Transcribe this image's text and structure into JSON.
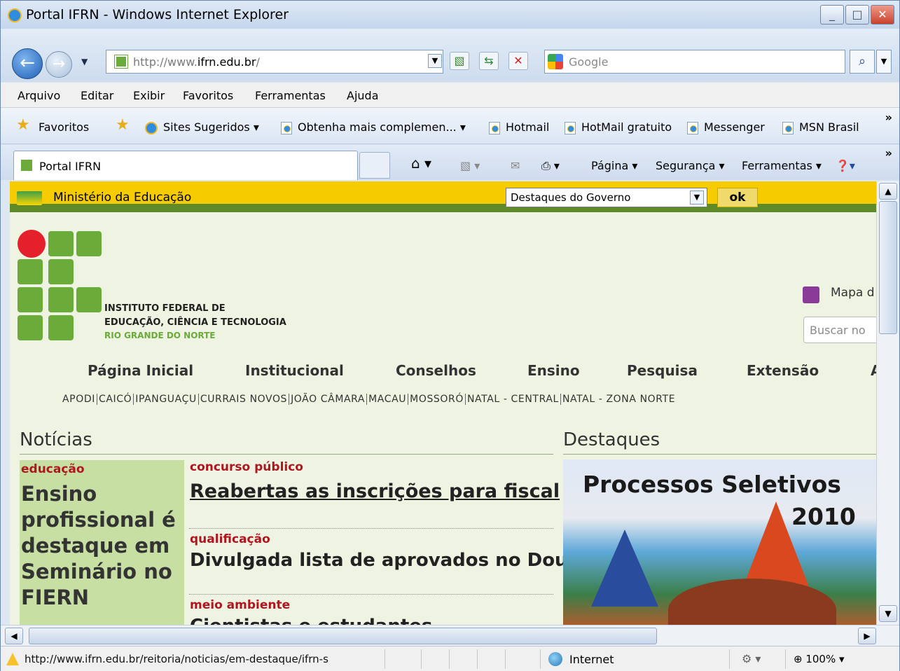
{
  "window": {
    "title": "Portal IFRN - Windows Internet Explorer"
  },
  "address": {
    "url_prefix": "http://www.",
    "url_domain": "ifrn.edu.br",
    "url_suffix": "/",
    "search_placeholder": "Google"
  },
  "menu": [
    "Arquivo",
    "Editar",
    "Exibir",
    "Favoritos",
    "Ferramentas",
    "Ajuda"
  ],
  "favorites": {
    "label": "Favoritos",
    "items": [
      "Sites Sugeridos ▾",
      "Obtenha mais complemen... ▾",
      "Hotmail",
      "HotMail gratuito",
      "Messenger",
      "MSN Brasil"
    ]
  },
  "tab": {
    "label": "Portal IFRN"
  },
  "commands": {
    "page": "Página ▾",
    "security": "Segurança ▾",
    "tools": "Ferramentas ▾"
  },
  "site": {
    "gov_label": "Ministério da Educação",
    "gov_select": "Destaques do Governo",
    "ok": "ok",
    "inst_line1": "INSTITUTO FEDERAL DE",
    "inst_line2": "EDUCAÇÃO, CIÊNCIA E TECNOLOGIA",
    "inst_line3": "RIO GRANDE DO NORTE",
    "mapa": "Mapa d",
    "search_placeholder": "Buscar no",
    "nav": [
      "Página Inicial",
      "Institucional",
      "Conselhos",
      "Ensino",
      "Pesquisa",
      "Extensão",
      "A"
    ],
    "campus": [
      "APODI",
      "CAICÓ",
      "IPANGUAÇU",
      "CURRAIS NOVOS",
      "JOÃO CÂMARA",
      "MACAU",
      "MOSSORÓ",
      "NATAL - CENTRAL",
      "NATAL - ZONA NORTE"
    ],
    "news_title": "Notícias",
    "highlights_title": "Destaques",
    "left_cat": "educação",
    "left_head": "Ensino profissional é destaque em Seminário no FIERN",
    "items": [
      {
        "cat": "concurso público",
        "title": "Reabertas as inscrições para fiscal"
      },
      {
        "cat": "qualificação",
        "title": "Divulgada lista de aprovados no Doutorado em Recursos Naturais"
      },
      {
        "cat": "meio ambiente",
        "title": "Cientistas e estudantes..."
      }
    ],
    "dest_title": "Processos Seletivos",
    "dest_year": "2010"
  },
  "status": {
    "url": "http://www.ifrn.edu.br/reitoria/noticias/em-destaque/ifrn-s",
    "zone": "Internet",
    "zoom": "100%"
  }
}
